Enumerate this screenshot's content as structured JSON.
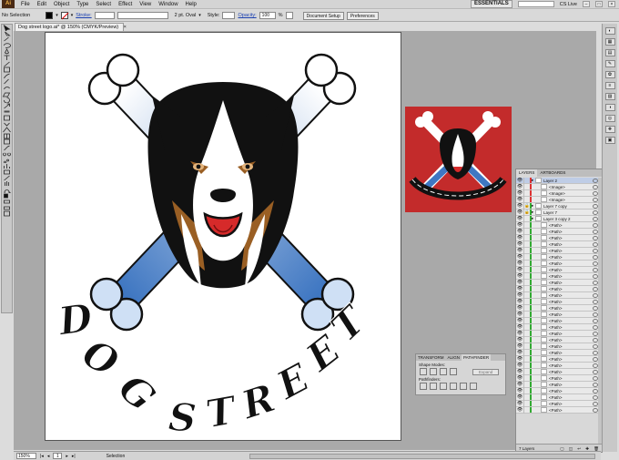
{
  "menubar": {
    "logo": "Ai",
    "items": [
      "File",
      "Edit",
      "Object",
      "Type",
      "Select",
      "Effect",
      "View",
      "Window",
      "Help"
    ],
    "workspace": "ESSENTIALS",
    "cslive": "CS Live"
  },
  "controlbar": {
    "selection": "No Selection",
    "stroke_label": "Stroke:",
    "stroke_size": "2 pt. Oval",
    "style_label": "Style:",
    "opacity_label": "Opacity:",
    "opacity_value": "100",
    "percent": "%",
    "document_setup": "Document Setup",
    "preferences": "Preferences",
    "fill_color": "#000000",
    "stroke_color": "#ffffff"
  },
  "document": {
    "tab_title": "Dog street logo.ai* @ 150% (CMYK/Preview)",
    "close": "×"
  },
  "artwork": {
    "word1": [
      "D",
      "O",
      "G"
    ],
    "word2": [
      "S",
      "T",
      "R",
      "E",
      "E",
      "T"
    ],
    "colors": {
      "bone_blue": "#3f77c2",
      "fur_black": "#111111",
      "fur_brown": "#9a5f24",
      "tongue": "#d62a2a",
      "thumb_bg": "#c32b2b"
    }
  },
  "layers": {
    "tabs": [
      "LAYERS",
      "ARTBOARDS"
    ],
    "rows": [
      {
        "name": "Layer 2",
        "indent": 0,
        "lock": false,
        "sel": true,
        "color": "#d33"
      },
      {
        "name": "<Image>",
        "indent": 1,
        "lock": false,
        "sel": false,
        "color": "#d33"
      },
      {
        "name": "<Image>",
        "indent": 1,
        "lock": false,
        "sel": false,
        "color": "#d33"
      },
      {
        "name": "<Image>",
        "indent": 1,
        "lock": false,
        "sel": false,
        "color": "#d33"
      },
      {
        "name": "Layer 7 copy",
        "indent": 0,
        "lock": true,
        "sel": false,
        "color": "#3a3"
      },
      {
        "name": "Layer 7",
        "indent": 0,
        "lock": true,
        "sel": false,
        "color": "#3a3"
      },
      {
        "name": "Layer 3 copy 2",
        "indent": 0,
        "lock": false,
        "sel": false,
        "color": "#3a3"
      },
      {
        "name": "<Path>",
        "indent": 1,
        "lock": false,
        "sel": false,
        "color": "#3a3"
      },
      {
        "name": "<Path>",
        "indent": 1,
        "lock": false,
        "sel": false,
        "color": "#3a3"
      },
      {
        "name": "<Path>",
        "indent": 1,
        "lock": false,
        "sel": false,
        "color": "#3a3"
      },
      {
        "name": "<Path>",
        "indent": 1,
        "lock": false,
        "sel": false,
        "color": "#3a3"
      },
      {
        "name": "<Path>",
        "indent": 1,
        "lock": false,
        "sel": false,
        "color": "#3a3"
      },
      {
        "name": "<Path>",
        "indent": 1,
        "lock": false,
        "sel": false,
        "color": "#3a3"
      },
      {
        "name": "<Path>",
        "indent": 1,
        "lock": false,
        "sel": false,
        "color": "#3a3"
      },
      {
        "name": "<Path>",
        "indent": 1,
        "lock": false,
        "sel": false,
        "color": "#3a3"
      },
      {
        "name": "<Path>",
        "indent": 1,
        "lock": false,
        "sel": false,
        "color": "#3a3"
      },
      {
        "name": "<Path>",
        "indent": 1,
        "lock": false,
        "sel": false,
        "color": "#3a3"
      },
      {
        "name": "<Path>",
        "indent": 1,
        "lock": false,
        "sel": false,
        "color": "#3a3"
      },
      {
        "name": "<Path>",
        "indent": 1,
        "lock": false,
        "sel": false,
        "color": "#3a3"
      },
      {
        "name": "<Path>",
        "indent": 1,
        "lock": false,
        "sel": false,
        "color": "#3a3"
      },
      {
        "name": "<Path>",
        "indent": 1,
        "lock": false,
        "sel": false,
        "color": "#3a3"
      },
      {
        "name": "<Path>",
        "indent": 1,
        "lock": false,
        "sel": false,
        "color": "#3a3"
      },
      {
        "name": "<Path>",
        "indent": 1,
        "lock": false,
        "sel": false,
        "color": "#3a3"
      },
      {
        "name": "<Path>",
        "indent": 1,
        "lock": false,
        "sel": false,
        "color": "#3a3"
      },
      {
        "name": "<Path>",
        "indent": 1,
        "lock": false,
        "sel": false,
        "color": "#3a3"
      },
      {
        "name": "<Path>",
        "indent": 1,
        "lock": false,
        "sel": false,
        "color": "#3a3"
      },
      {
        "name": "<Path>",
        "indent": 1,
        "lock": false,
        "sel": false,
        "color": "#3a3"
      },
      {
        "name": "<Path>",
        "indent": 1,
        "lock": false,
        "sel": false,
        "color": "#3a3"
      },
      {
        "name": "<Path>",
        "indent": 1,
        "lock": false,
        "sel": false,
        "color": "#3a3"
      },
      {
        "name": "<Path>",
        "indent": 1,
        "lock": false,
        "sel": false,
        "color": "#3a3"
      },
      {
        "name": "<Path>",
        "indent": 1,
        "lock": false,
        "sel": false,
        "color": "#3a3"
      },
      {
        "name": "<Path>",
        "indent": 1,
        "lock": false,
        "sel": false,
        "color": "#3a3"
      },
      {
        "name": "<Path>",
        "indent": 1,
        "lock": false,
        "sel": false,
        "color": "#3a3"
      },
      {
        "name": "<Path>",
        "indent": 1,
        "lock": false,
        "sel": false,
        "color": "#3a3"
      },
      {
        "name": "<Path>",
        "indent": 1,
        "lock": false,
        "sel": false,
        "color": "#3a3"
      },
      {
        "name": "<Path>",
        "indent": 1,
        "lock": false,
        "sel": false,
        "color": "#3a3"
      },
      {
        "name": "<Path>",
        "indent": 1,
        "lock": false,
        "sel": false,
        "color": "#3a3"
      }
    ],
    "footer": "7 Layers"
  },
  "pathfinder": {
    "tabs": [
      "TRANSFORM",
      "ALIGN",
      "PATHFINDER"
    ],
    "shape_modes": "Shape Modes:",
    "pathfinders": "Pathfinders:",
    "expand": "Expand"
  },
  "status": {
    "zoom": "150%",
    "page": "1",
    "mode": "Selection"
  }
}
